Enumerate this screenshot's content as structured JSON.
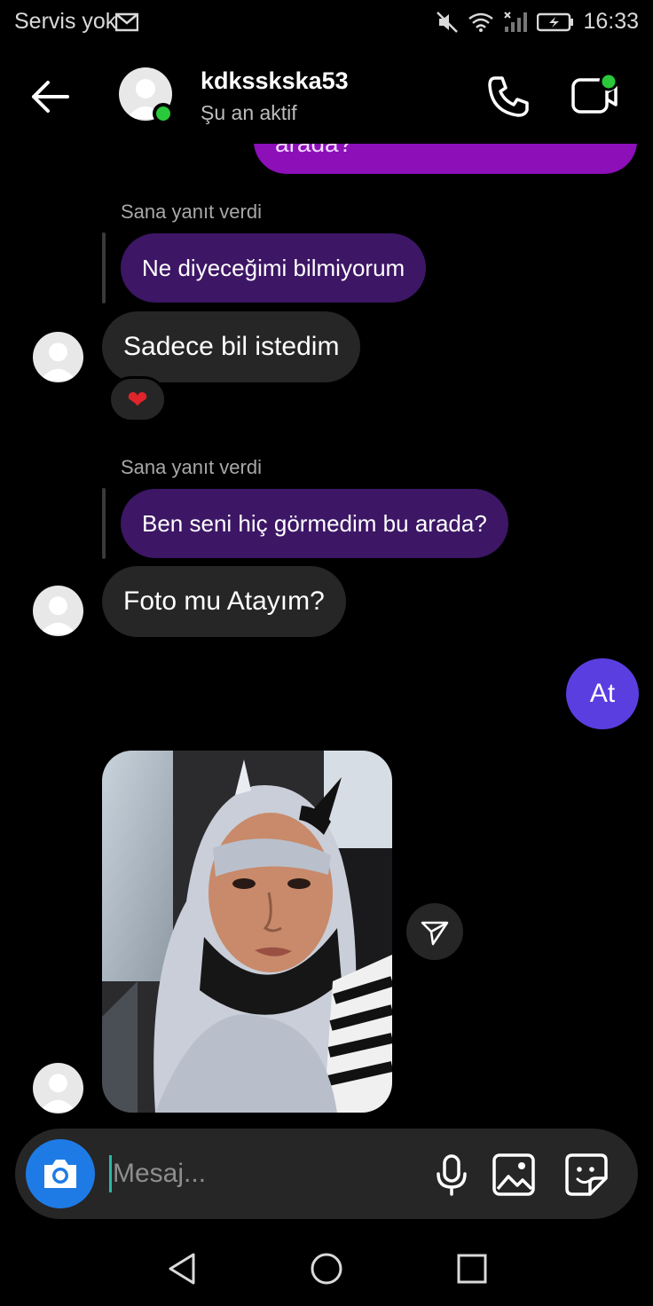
{
  "status_bar": {
    "carrier": "Servis yok",
    "time": "16:33",
    "icons": [
      "mail-icon",
      "mute-icon",
      "wifi-icon",
      "signal-icon",
      "battery-charging-icon"
    ]
  },
  "header": {
    "username": "kdksskska53",
    "presence": "Şu an aktif",
    "online_color": "#29c93b",
    "icons": [
      "back-arrow-icon",
      "phone-icon",
      "video-call-icon"
    ]
  },
  "messages": {
    "partial_sent_text": "arada?",
    "reply1": {
      "label": "Sana yanıt verdi",
      "quoted": "Ne diyeceğimi bilmiyorum"
    },
    "msg1": {
      "text": "Sadece bil istedim",
      "reaction": "❤"
    },
    "reply2": {
      "label": "Sana yanıt verdi",
      "quoted": "Ben seni hiç görmedim bu arada?"
    },
    "msg2": {
      "text": "Foto mu Atayım?"
    },
    "sent1": {
      "text": "At"
    },
    "photo": {
      "description_icon": "photo-message"
    }
  },
  "composer": {
    "placeholder": "Mesaj...",
    "icons": [
      "camera-icon",
      "microphone-icon",
      "gallery-icon",
      "sticker-icon"
    ]
  },
  "colors": {
    "sent_bubble": "#8c0fb8",
    "reply_bubble": "#3d1665",
    "received_bubble": "#262626",
    "sent_round": "#5b3ee0",
    "camera_button": "#1e7be6"
  }
}
